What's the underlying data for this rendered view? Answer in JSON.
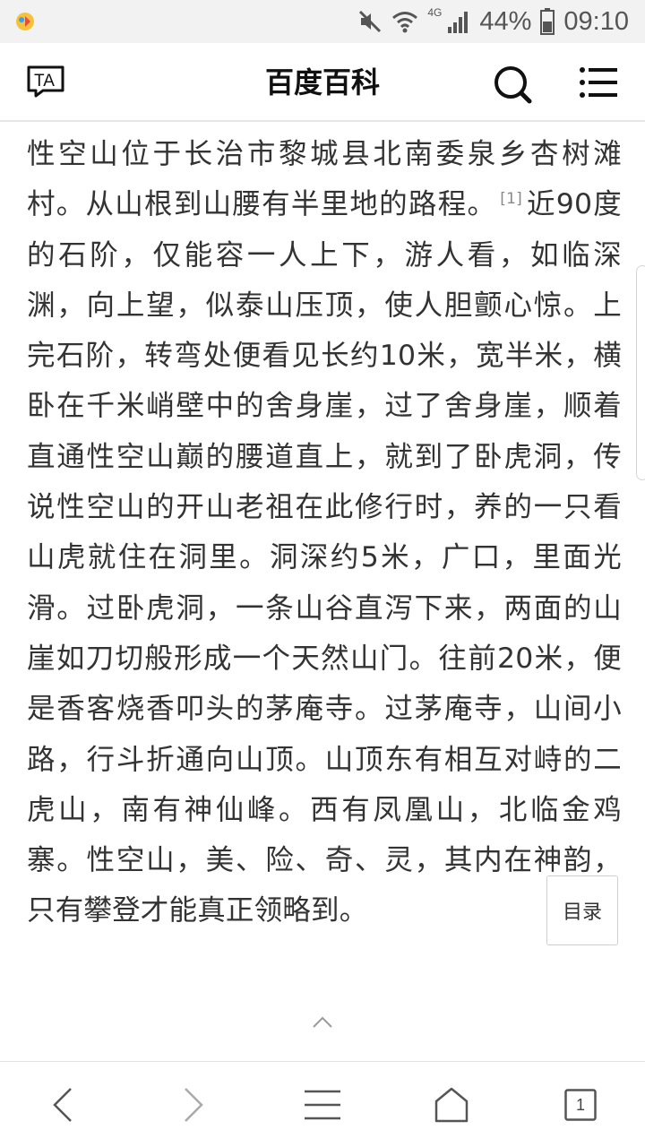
{
  "status_bar": {
    "network": "4G",
    "battery": "44%",
    "time": "09:10"
  },
  "header": {
    "title": "百度百科",
    "left_icon_text": "TA"
  },
  "article": {
    "text_part1": "性空山位于长治市黎城县北南委泉乡杏树滩村。从山根到山腰有半里地的路程。",
    "ref": "[1]",
    "text_part2": "近90度的石阶，仅能容一人上下，游人看，如临深渊，向上望，似泰山压顶，使人胆颤心惊。上完石阶，转弯处便看见长约10米，宽半米，横卧在千米峭壁中的舍身崖，过了舍身崖，顺着直通性空山巅的腰道直上，就到了卧虎洞，传说性空山的开山老祖在此修行时，养的一只看山虎就住在洞里。洞深约5米，广口，里面光滑。过卧虎洞，一条山谷直泻下来，两面的山崖如刀切般形成一个天然山门。往前20米，便是香客烧香叩头的茅庵寺。过茅庵寺，山间小路，行斗折通向山顶。山顶东有相互对峙的二虎山，南有神仙峰。西有凤凰山，北临金鸡寨。性空山，美、险、奇、灵，其内在神韵，只有攀登才能真正领略到。"
  },
  "toc_button": "目录",
  "bottom_bar": {
    "tab_count": "1"
  },
  "icons": {
    "status": [
      "app-icon",
      "mute-icon",
      "wifi-icon",
      "signal-icon",
      "battery-icon"
    ],
    "header": [
      "text-size-icon",
      "search-icon",
      "menu-icon"
    ],
    "bottom": [
      "back-icon",
      "forward-icon",
      "menu-icon",
      "home-icon",
      "tabs-icon"
    ]
  },
  "colors": {
    "status_bar_bg": "#f2f2f2",
    "text": "#333333",
    "title": "#111111"
  }
}
